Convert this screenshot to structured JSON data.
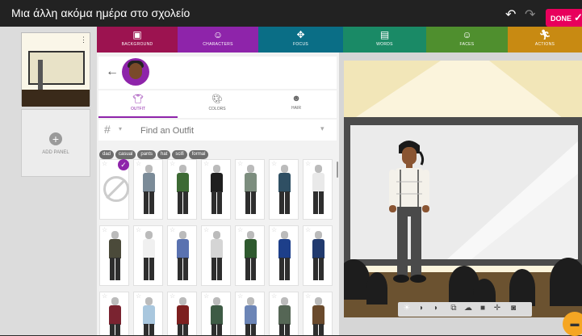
{
  "app": {
    "title": "Μια άλλη ακόμα ημέρα στο σχολείο",
    "done_label": "DONE"
  },
  "left_panel": {
    "add_panel_label": "ADD PANEL"
  },
  "category_tabs": [
    {
      "label": "BACKGROUND",
      "icon": "image-icon",
      "color": "#9c1350"
    },
    {
      "label": "CHARACTERS",
      "icon": "face-icon",
      "color": "#8e24aa"
    },
    {
      "label": "FOCUS",
      "icon": "move-icon",
      "color": "#0a6e86"
    },
    {
      "label": "WORDS",
      "icon": "speech-icon",
      "color": "#1a8a66"
    },
    {
      "label": "FACES",
      "icon": "smile-icon",
      "color": "#4f8f2e"
    },
    {
      "label": "ACTIONS",
      "icon": "run-icon",
      "color": "#c88a12"
    }
  ],
  "character_tabs": [
    {
      "label": "OUTFIT",
      "icon": "outfit-icon"
    },
    {
      "label": "COLORS",
      "icon": "palette-icon"
    },
    {
      "label": "HAIR",
      "icon": "hair-icon"
    }
  ],
  "search": {
    "placeholder": "Find an Outfit"
  },
  "tags": [
    "dad",
    "casual",
    "pants",
    "hat",
    "scifi",
    "formal"
  ],
  "outfits": {
    "selected_index": 0,
    "colors": [
      "#7b8b98",
      "#3d6a34",
      "#1f1f1f",
      "#7c8d7e",
      "#2f4f63",
      "#e9e9e9",
      "#4b4a3a",
      "#f0f0f0",
      "#5a72b0",
      "#d5d5d5",
      "#2f5a2f",
      "#1d3f8a",
      "#213a6e",
      "#7a2330",
      "#a9c7de",
      "#7d1f1f",
      "#3e5b45",
      "#6c85b6",
      "#556655",
      "#6a4a2c"
    ]
  },
  "colors": {
    "topbar": "#222222",
    "accent": "#8e24aa",
    "done": "#e8005c",
    "chat": "#f5a623"
  }
}
